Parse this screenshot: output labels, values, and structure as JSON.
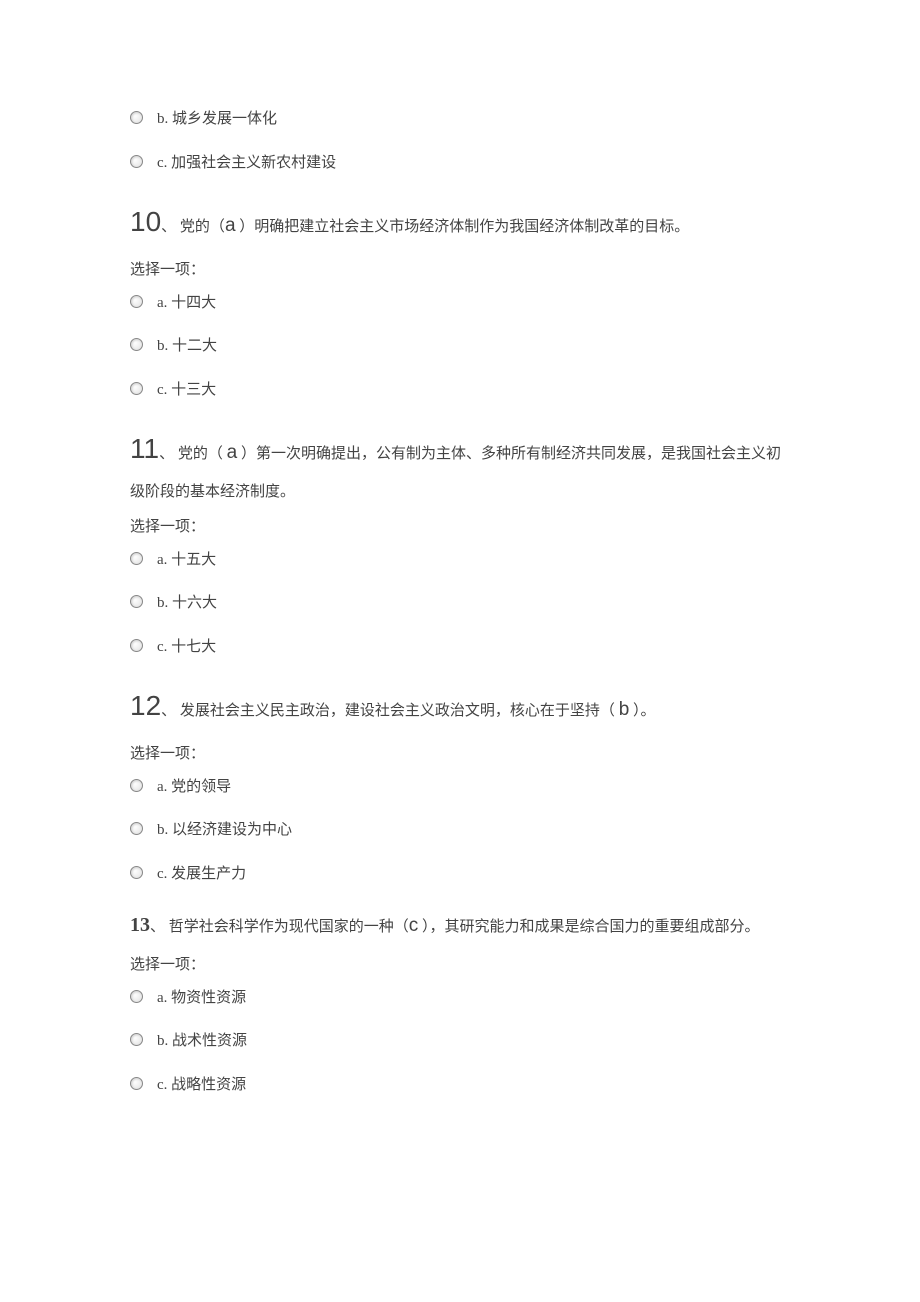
{
  "selectLabel": "选择一项：",
  "orphanOptions": [
    {
      "letter": "b.",
      "text": "城乡发展一体化"
    },
    {
      "letter": "c.",
      "text": "加强社会主义新农村建设"
    }
  ],
  "questions": [
    {
      "num": "10",
      "enumerator": "、",
      "pre": "党的（",
      "answer": "a",
      "post": "   ）明确把建立社会主义市场经济体制作为我国经济体制改革的目标。",
      "options": [
        {
          "letter": "a.",
          "text": "十四大"
        },
        {
          "letter": "b.",
          "text": "十二大"
        },
        {
          "letter": "c.",
          "text": "十三大"
        }
      ]
    },
    {
      "num": "11",
      "enumerator": "、",
      "pre": "党的（   ",
      "answer": "a",
      "post": " ）第一次明确提出，公有制为主体、多种所有制经济共同发展，是我国社会主义初级阶段的基本经济制度。",
      "options": [
        {
          "letter": "a.",
          "text": "十五大"
        },
        {
          "letter": "b.",
          "text": "十六大"
        },
        {
          "letter": "c.",
          "text": "十七大"
        }
      ]
    },
    {
      "num": "12",
      "enumerator": "、",
      "pre": "发展社会主义民主政治，建设社会主义政治文明，核心在于坚持（ ",
      "answer": "b",
      "post": "   ）。",
      "options": [
        {
          "letter": "a.",
          "text": "党的领导"
        },
        {
          "letter": "b.",
          "text": "以经济建设为中心"
        },
        {
          "letter": "c.",
          "text": "发展生产力"
        }
      ]
    },
    {
      "num": "13",
      "enumerator": "、",
      "numStyle": "alt",
      "pre": "哲学社会科学作为现代国家的一种（",
      "answer": "c",
      "post": "   ），其研究能力和成果是综合国力的重要组成部分。",
      "options": [
        {
          "letter": "a.",
          "text": "物资性资源"
        },
        {
          "letter": "b.",
          "text": "战术性资源"
        },
        {
          "letter": "c.",
          "text": "战略性资源"
        }
      ]
    }
  ]
}
